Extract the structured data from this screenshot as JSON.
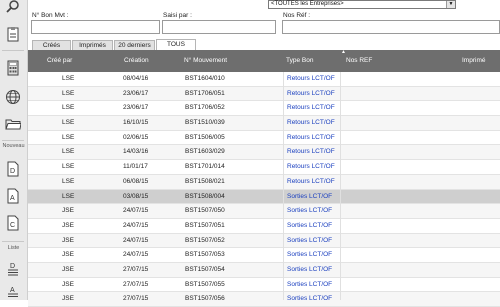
{
  "sidebar": {
    "nouveau_label": "Nouveau",
    "liste_label": "Liste"
  },
  "filters": {
    "entreprise": "<TOUTES les Entreprises>",
    "bon_label": "N° Bon Mvt :",
    "saisi_label": "Saisi par :",
    "ref_label": "Nos Réf :"
  },
  "tabs": [
    "Créés",
    "Imprimés",
    "20 derniers",
    "TOUS"
  ],
  "columns": {
    "cree_par": "Créé par",
    "creation": "Création",
    "mouvement": "N° Mouvement",
    "type_bon": "Type Bon",
    "nos_ref": "Nos REF",
    "imprime": "Imprimé"
  },
  "rows": [
    {
      "cree_par": "LSE",
      "creation": "08/04/16",
      "mouvement": "BST1604/010",
      "type": "Retours LCT/OF"
    },
    {
      "cree_par": "LSE",
      "creation": "23/06/17",
      "mouvement": "BST1706/051",
      "type": "Retours LCT/OF"
    },
    {
      "cree_par": "LSE",
      "creation": "23/06/17",
      "mouvement": "BST1706/052",
      "type": "Retours LCT/OF"
    },
    {
      "cree_par": "LSE",
      "creation": "16/10/15",
      "mouvement": "BST1510/039",
      "type": "Retours LCT/OF"
    },
    {
      "cree_par": "LSE",
      "creation": "02/06/15",
      "mouvement": "BST1506/005",
      "type": "Retours LCT/OF"
    },
    {
      "cree_par": "LSE",
      "creation": "14/03/16",
      "mouvement": "BST1603/029",
      "type": "Retours LCT/OF"
    },
    {
      "cree_par": "LSE",
      "creation": "11/01/17",
      "mouvement": "BST1701/014",
      "type": "Retours LCT/OF"
    },
    {
      "cree_par": "LSE",
      "creation": "06/08/15",
      "mouvement": "BST1508/021",
      "type": "Retours LCT/OF"
    },
    {
      "cree_par": "LSE",
      "creation": "03/08/15",
      "mouvement": "BST1508/004",
      "type": "Sorties LCT/OF"
    },
    {
      "cree_par": "JSE",
      "creation": "24/07/15",
      "mouvement": "BST1507/050",
      "type": "Sorties LCT/OF"
    },
    {
      "cree_par": "JSE",
      "creation": "24/07/15",
      "mouvement": "BST1507/051",
      "type": "Sorties LCT/OF"
    },
    {
      "cree_par": "JSE",
      "creation": "24/07/15",
      "mouvement": "BST1507/052",
      "type": "Sorties LCT/OF"
    },
    {
      "cree_par": "JSE",
      "creation": "24/07/15",
      "mouvement": "BST1507/053",
      "type": "Sorties LCT/OF"
    },
    {
      "cree_par": "JSE",
      "creation": "27/07/15",
      "mouvement": "BST1507/054",
      "type": "Sorties LCT/OF"
    },
    {
      "cree_par": "JSE",
      "creation": "27/07/15",
      "mouvement": "BST1507/055",
      "type": "Sorties LCT/OF"
    },
    {
      "cree_par": "JSE",
      "creation": "27/07/15",
      "mouvement": "BST1507/056",
      "type": "Sorties LCT/OF"
    }
  ],
  "colors": {
    "header_bg": "#6e6e6e",
    "selected_row": "#cfcfcf",
    "type_text": "#1a3fbf"
  }
}
